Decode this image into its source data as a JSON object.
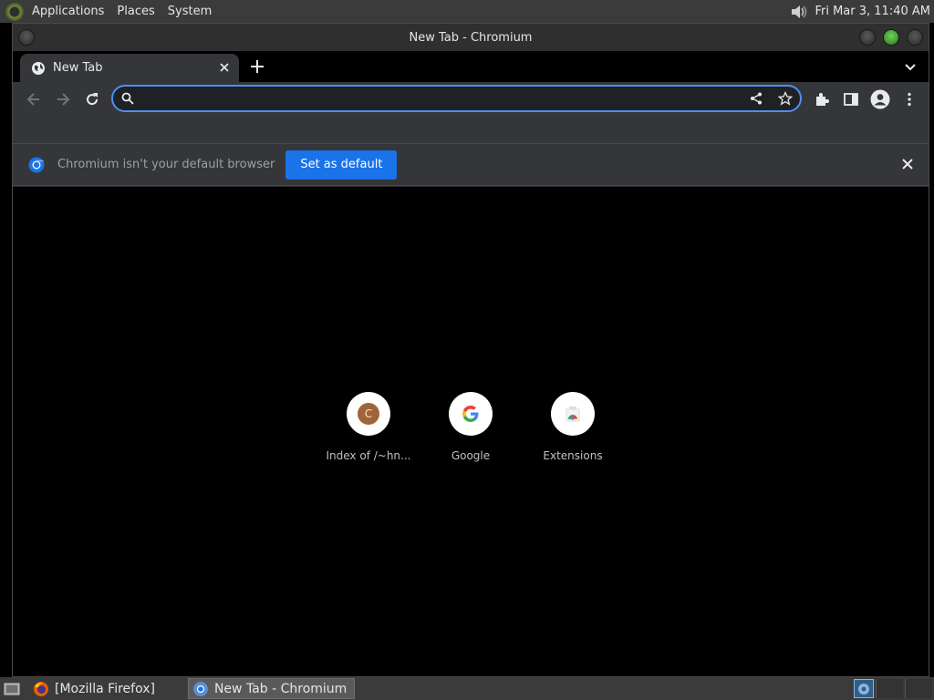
{
  "top_panel": {
    "menus": [
      "Applications",
      "Places",
      "System"
    ],
    "clock": "Fri Mar  3, 11:40 AM"
  },
  "window": {
    "title": "New Tab - Chromium"
  },
  "tabstrip": {
    "tab_title": "New Tab"
  },
  "toolbar": {
    "omnibox_value": ""
  },
  "infobar": {
    "message": "Chromium isn't your default browser",
    "button_label": "Set as default"
  },
  "shortcuts": [
    {
      "label": "Index of /~hn...",
      "icon": "letter-c-icon",
      "letter": "C"
    },
    {
      "label": "Google",
      "icon": "google-icon"
    },
    {
      "label": "Extensions",
      "icon": "extensions-icon"
    }
  ],
  "taskbar": {
    "tasks": [
      "[Mozilla Firefox]",
      "New Tab - Chromium"
    ]
  },
  "colors": {
    "accent": "#1a73e8",
    "omnibox_focus": "#4d8ff5",
    "toolbar_bg": "#35363a",
    "page_bg": "#000000"
  }
}
